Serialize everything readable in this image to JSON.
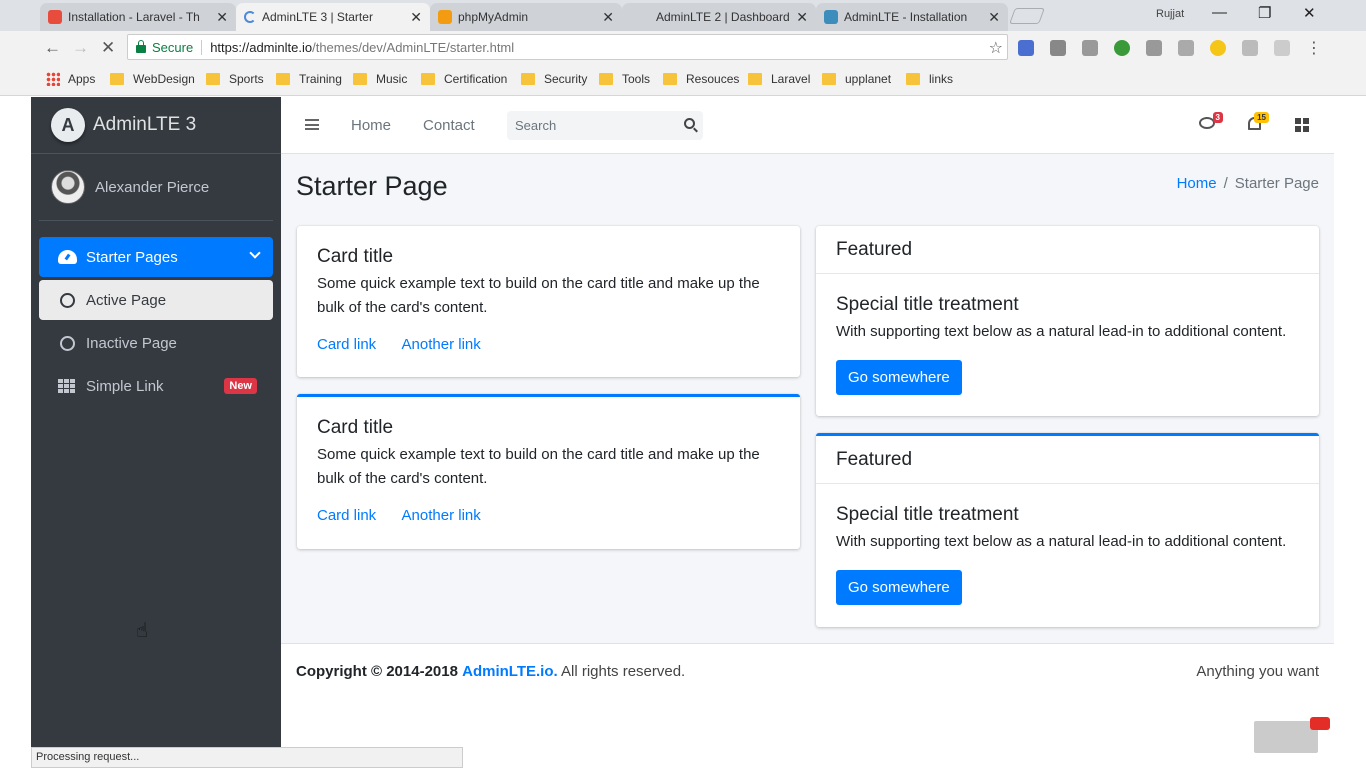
{
  "browser": {
    "tabs": [
      {
        "title": "Installation - Laravel - Th",
        "favicon_color": "#e74c3c"
      },
      {
        "title": "AdminLTE 3 | Starter",
        "favicon_color": "#4a89dc"
      },
      {
        "title": "phpMyAdmin",
        "favicon_color": "#f39c12"
      },
      {
        "title": "AdminLTE 2 | Dashboard",
        "favicon_color": "#bbbbbb"
      },
      {
        "title": "AdminLTE - Installation",
        "favicon_color": "#3c8dbc"
      }
    ],
    "user": "Rujjat",
    "secure_label": "Secure",
    "url_host": "https://adminlte.io",
    "url_path": "/themes/dev/AdminLTE/starter.html",
    "bookmarks": [
      "Apps",
      "WebDesign",
      "Sports",
      "Training",
      "Music",
      "Certification",
      "Security",
      "Tools",
      "Resouces",
      "Laravel",
      "upplanet",
      "links"
    ],
    "status_text": "Processing request..."
  },
  "sidebar": {
    "brand": "AdminLTE 3",
    "user_name": "Alexander Pierce",
    "items": [
      {
        "label": "Starter Pages",
        "icon": "dashboard-icon"
      },
      {
        "label": "Active Page",
        "icon": "circle-icon"
      },
      {
        "label": "Inactive Page",
        "icon": "circle-icon"
      },
      {
        "label": "Simple Link",
        "icon": "th-icon",
        "badge": "New"
      }
    ]
  },
  "topnav": {
    "links": [
      "Home",
      "Contact"
    ],
    "search_placeholder": "Search",
    "messages_count": "3",
    "notifications_count": "15"
  },
  "page": {
    "title": "Starter Page",
    "breadcrumb": [
      "Home",
      "Starter Page"
    ]
  },
  "cards": {
    "left": [
      {
        "title": "Card title",
        "text": "Some quick example text to build on the card title and make up the bulk of the card's content.",
        "link1": "Card link",
        "link2": "Another link"
      },
      {
        "title": "Card title",
        "text": "Some quick example text to build on the card title and make up the bulk of the card's content.",
        "link1": "Card link",
        "link2": "Another link"
      }
    ],
    "right": [
      {
        "header": "Featured",
        "title": "Special title treatment",
        "text": "With supporting text below as a natural lead-in to additional content.",
        "button": "Go somewhere"
      },
      {
        "header": "Featured",
        "title": "Special title treatment",
        "text": "With supporting text below as a natural lead-in to additional content.",
        "button": "Go somewhere"
      }
    ]
  },
  "footer": {
    "copyright_prefix": "Copyright © 2014-2018",
    "copyright_link": "AdminLTE.io.",
    "copyright_suffix": "All rights reserved.",
    "right_text": "Anything you want"
  },
  "colors": {
    "primary": "#007bff",
    "sidebar": "#343a40",
    "danger": "#dc3545",
    "warning": "#ffc107"
  }
}
